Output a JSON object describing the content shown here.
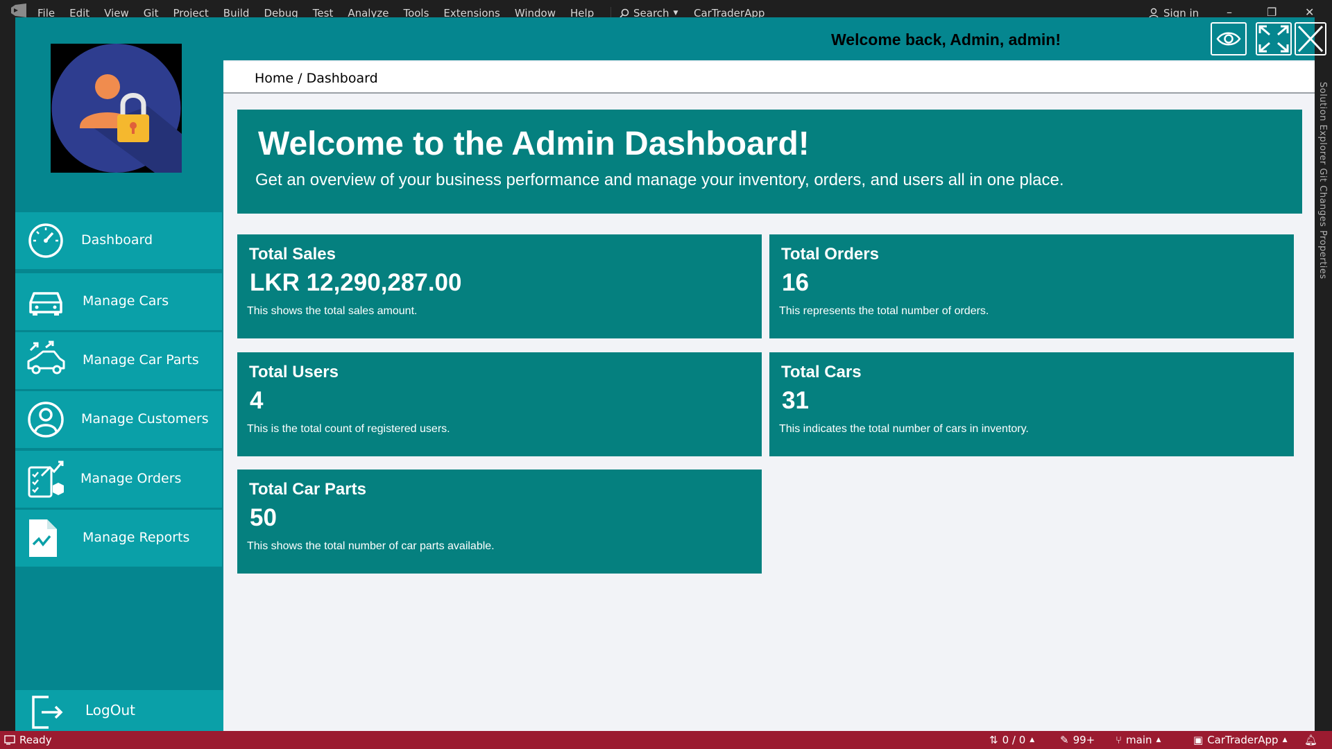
{
  "host": {
    "menu": [
      "File",
      "Edit",
      "View",
      "Git",
      "Project",
      "Build",
      "Debug",
      "Test",
      "Analyze",
      "Tools",
      "Extensions",
      "Window",
      "Help"
    ],
    "search_label": "Search",
    "app_title": "CarTraderApp",
    "sign_in": "Sign in",
    "right_panel_text": "Solution Explorer   Git Changes   Properties",
    "status": {
      "ready": "Ready",
      "arrows": "0 / 0",
      "edits": "99+",
      "branch": "main",
      "project": "CarTraderApp"
    }
  },
  "app": {
    "welcome": "Welcome back, Admin, admin!",
    "breadcrumb": "Home / Dashboard",
    "nav": [
      {
        "label": "Dashboard",
        "icon": "dashboard-gauge-icon"
      },
      {
        "label": "Manage Cars",
        "icon": "car-icon"
      },
      {
        "label": "Manage Car Parts",
        "icon": "car-parts-icon"
      },
      {
        "label": "Manage Customers",
        "icon": "user-circle-icon"
      },
      {
        "label": "Manage Orders",
        "icon": "orders-checklist-icon"
      },
      {
        "label": "Manage Reports",
        "icon": "report-chart-icon"
      }
    ],
    "logout": "LogOut",
    "hero": {
      "title": "Welcome to the Admin Dashboard!",
      "subtitle": "Get an overview of your business performance and manage your inventory, orders, and users all in one place."
    },
    "cards": [
      {
        "title": "Total Sales",
        "value": "LKR 12,290,287.00",
        "desc": "This shows the total sales amount."
      },
      {
        "title": "Total Orders",
        "value": "16",
        "desc": "This represents the total number of orders."
      },
      {
        "title": "Total Users",
        "value": "4",
        "desc": "This is the total count of registered users."
      },
      {
        "title": "Total Cars",
        "value": "31",
        "desc": "This indicates the total number of cars in inventory."
      },
      {
        "title": "Total Car Parts",
        "value": "50",
        "desc": "This shows the total number of car parts available."
      }
    ],
    "colors": {
      "sidebar": "#05868f",
      "nav_item": "#0aa0a8",
      "card": "#05807f",
      "status_bar": "#9b1b30"
    }
  }
}
